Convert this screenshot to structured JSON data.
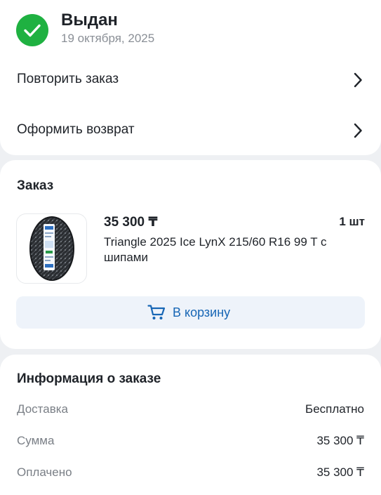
{
  "status": {
    "title": "Выдан",
    "date": "19 октября, 2025",
    "icon": "check-circle-icon",
    "color": "#1fb141"
  },
  "actions": [
    {
      "label": "Повторить заказ",
      "icon": "chevron-right-icon"
    },
    {
      "label": "Оформить возврат",
      "icon": "chevron-right-icon"
    }
  ],
  "order": {
    "title": "Заказ",
    "item": {
      "price": "35 300 ₸",
      "quantity": "1 шт",
      "name": "Triangle 2025 Ice LynX 215/60 R16 99 T с шипами",
      "image": "tire-image"
    },
    "cart_button": {
      "label": "В корзину",
      "icon": "cart-icon"
    }
  },
  "info": {
    "title": "Информация о заказе",
    "rows": [
      {
        "key": "Доставка",
        "value": "Бесплатно"
      },
      {
        "key": "Сумма",
        "value": "35 300 ₸"
      },
      {
        "key": "Оплачено",
        "value": "35 300 ₸"
      }
    ]
  },
  "colors": {
    "accent": "#1766b5",
    "button_bg": "#eef3fa",
    "success": "#1fb141",
    "background": "#eef0f3"
  }
}
